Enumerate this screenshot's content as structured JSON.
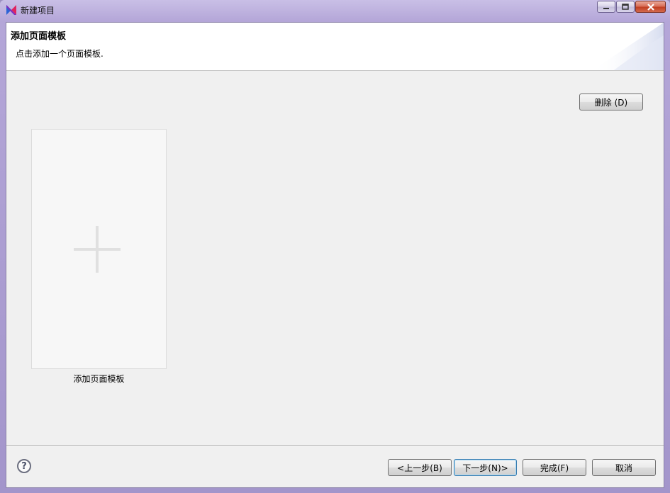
{
  "window": {
    "title": "新建项目",
    "icons": {
      "app": "app-logo-icon",
      "minimize": "minimize-icon",
      "maximize": "maximize-icon",
      "close": "close-icon"
    }
  },
  "banner": {
    "title": "添加页面模板",
    "description": "点击添加一个页面模板."
  },
  "actions": {
    "delete_label": "删除 (D)"
  },
  "templates": {
    "add_label": "添加页面模板",
    "add_icon": "plus-icon"
  },
  "footer": {
    "help_icon": "help-icon",
    "help_glyph": "?",
    "back_label": "<上一步(B)",
    "next_label": "下一步(N)>",
    "finish_label": "完成(F)",
    "cancel_label": "取消"
  },
  "colors": {
    "titlebar": "#b4a6d8",
    "client_bg": "#f0f0f0",
    "default_button_border": "#3c7fb1"
  }
}
